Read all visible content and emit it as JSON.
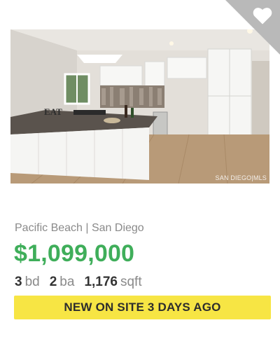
{
  "listing": {
    "photo_alt": "kitchen-photo",
    "photo_watermark": "SAN DIEGO|MLS",
    "photo_sign_text": "EAT",
    "location": "Pacific Beach | San Diego",
    "price": "$1,099,000",
    "beds": "3",
    "beds_unit": "bd",
    "baths": "2",
    "baths_unit": "ba",
    "sqft": "1,176",
    "sqft_unit": "sqft",
    "badge": "NEW ON SITE 3 DAYS AGO"
  },
  "favorite": {
    "icon": "heart-icon"
  },
  "colors": {
    "price": "#3fae5a",
    "badge_bg": "#f7e544",
    "corner": "#b9b9b9"
  }
}
